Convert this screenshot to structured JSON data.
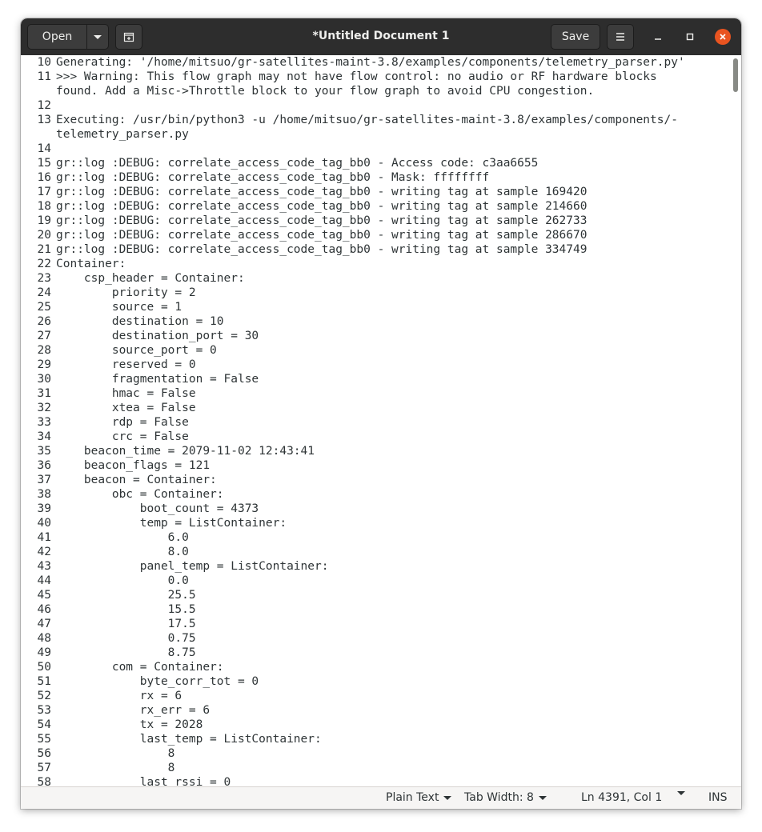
{
  "header": {
    "open_label": "Open",
    "save_label": "Save",
    "title": "*Untitled Document 1"
  },
  "statusbar": {
    "language": "Plain Text",
    "tab_width": "Tab Width: 8",
    "cursor": "Ln 4391, Col 1",
    "mode": "INS"
  },
  "editor": {
    "lines": [
      {
        "n": "10",
        "t": "Generating: '/home/mitsuo/gr-satellites-maint-3.8/examples/components/telemetry_parser.py'"
      },
      {
        "n": "11",
        "t": ">>> Warning: This flow graph may not have flow control: no audio or RF hardware blocks"
      },
      {
        "n": "",
        "t": "found. Add a Misc->Throttle block to your flow graph to avoid CPU congestion."
      },
      {
        "n": "12",
        "t": ""
      },
      {
        "n": "13",
        "t": "Executing: /usr/bin/python3 -u /home/mitsuo/gr-satellites-maint-3.8/examples/components/-"
      },
      {
        "n": "",
        "t": "telemetry_parser.py"
      },
      {
        "n": "14",
        "t": ""
      },
      {
        "n": "15",
        "t": "gr::log :DEBUG: correlate_access_code_tag_bb0 - Access code: c3aa6655"
      },
      {
        "n": "16",
        "t": "gr::log :DEBUG: correlate_access_code_tag_bb0 - Mask: ffffffff"
      },
      {
        "n": "17",
        "t": "gr::log :DEBUG: correlate_access_code_tag_bb0 - writing tag at sample 169420"
      },
      {
        "n": "18",
        "t": "gr::log :DEBUG: correlate_access_code_tag_bb0 - writing tag at sample 214660"
      },
      {
        "n": "19",
        "t": "gr::log :DEBUG: correlate_access_code_tag_bb0 - writing tag at sample 262733"
      },
      {
        "n": "20",
        "t": "gr::log :DEBUG: correlate_access_code_tag_bb0 - writing tag at sample 286670"
      },
      {
        "n": "21",
        "t": "gr::log :DEBUG: correlate_access_code_tag_bb0 - writing tag at sample 334749"
      },
      {
        "n": "22",
        "t": "Container:"
      },
      {
        "n": "23",
        "t": "    csp_header = Container:"
      },
      {
        "n": "24",
        "t": "        priority = 2"
      },
      {
        "n": "25",
        "t": "        source = 1"
      },
      {
        "n": "26",
        "t": "        destination = 10"
      },
      {
        "n": "27",
        "t": "        destination_port = 30"
      },
      {
        "n": "28",
        "t": "        source_port = 0"
      },
      {
        "n": "29",
        "t": "        reserved = 0"
      },
      {
        "n": "30",
        "t": "        fragmentation = False"
      },
      {
        "n": "31",
        "t": "        hmac = False"
      },
      {
        "n": "32",
        "t": "        xtea = False"
      },
      {
        "n": "33",
        "t": "        rdp = False"
      },
      {
        "n": "34",
        "t": "        crc = False"
      },
      {
        "n": "35",
        "t": "    beacon_time = 2079-11-02 12:43:41"
      },
      {
        "n": "36",
        "t": "    beacon_flags = 121"
      },
      {
        "n": "37",
        "t": "    beacon = Container:"
      },
      {
        "n": "38",
        "t": "        obc = Container:"
      },
      {
        "n": "39",
        "t": "            boot_count = 4373"
      },
      {
        "n": "40",
        "t": "            temp = ListContainer:"
      },
      {
        "n": "41",
        "t": "                6.0"
      },
      {
        "n": "42",
        "t": "                8.0"
      },
      {
        "n": "43",
        "t": "            panel_temp = ListContainer:"
      },
      {
        "n": "44",
        "t": "                0.0"
      },
      {
        "n": "45",
        "t": "                25.5"
      },
      {
        "n": "46",
        "t": "                15.5"
      },
      {
        "n": "47",
        "t": "                17.5"
      },
      {
        "n": "48",
        "t": "                0.75"
      },
      {
        "n": "49",
        "t": "                8.75"
      },
      {
        "n": "50",
        "t": "        com = Container:"
      },
      {
        "n": "51",
        "t": "            byte_corr_tot = 0"
      },
      {
        "n": "52",
        "t": "            rx = 6"
      },
      {
        "n": "53",
        "t": "            rx_err = 6"
      },
      {
        "n": "54",
        "t": "            tx = 2028"
      },
      {
        "n": "55",
        "t": "            last_temp = ListContainer:"
      },
      {
        "n": "56",
        "t": "                8"
      },
      {
        "n": "57",
        "t": "                8"
      },
      {
        "n": "58",
        "t": "            last_rssi = 0"
      }
    ]
  }
}
